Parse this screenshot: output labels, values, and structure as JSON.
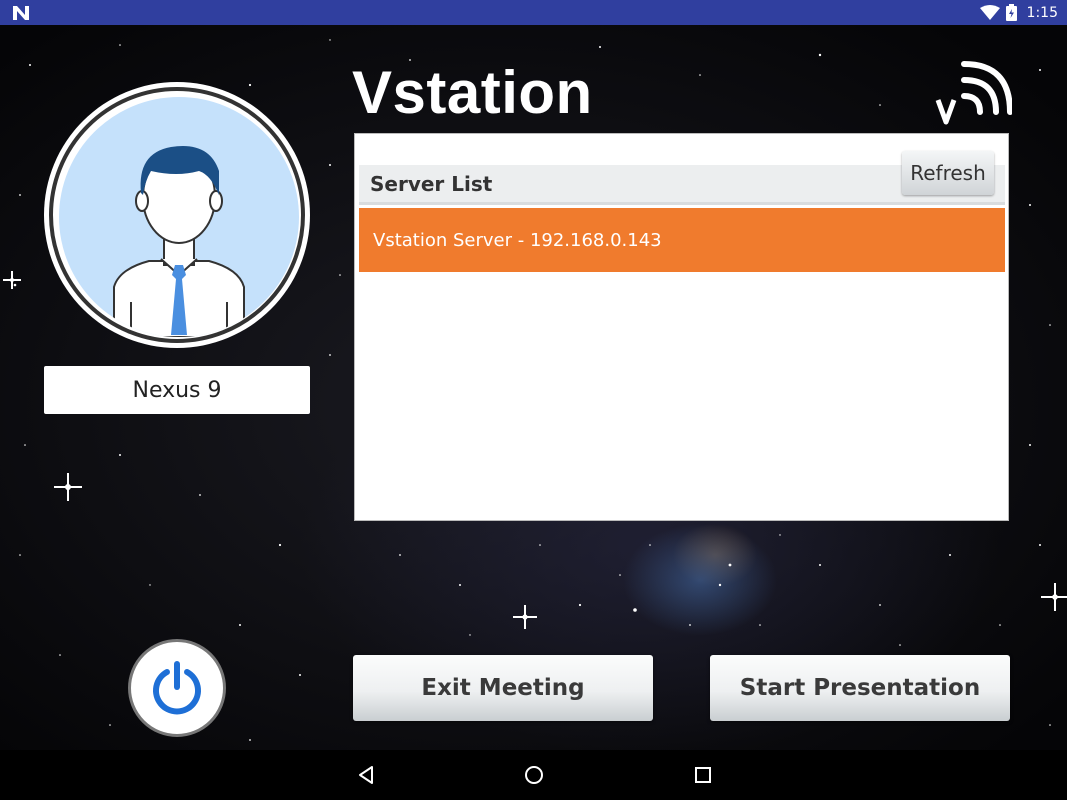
{
  "status_bar": {
    "time": "1:15",
    "icons": [
      "notification-n-icon",
      "wifi-icon",
      "battery-icon"
    ]
  },
  "app": {
    "title": "Vstation",
    "cast_icon": "vstation-cast-icon"
  },
  "profile": {
    "avatar_icon": "user-avatar-icon",
    "device_name": "Nexus 9"
  },
  "server_list": {
    "header": "Server List",
    "refresh_label": "Refresh",
    "items": [
      "Vstation Server - 192.168.0.143"
    ]
  },
  "actions": {
    "power_icon": "power-icon",
    "exit_label": "Exit Meeting",
    "start_label": "Start Presentation"
  },
  "nav_bar": {
    "icons": [
      "back-icon",
      "home-icon",
      "recents-icon"
    ]
  },
  "colors": {
    "status_bar": "#303f9f",
    "selected_server": "#f07b2d",
    "power_accent": "#1e6fd6",
    "avatar_bg": "#c5e1fb"
  }
}
